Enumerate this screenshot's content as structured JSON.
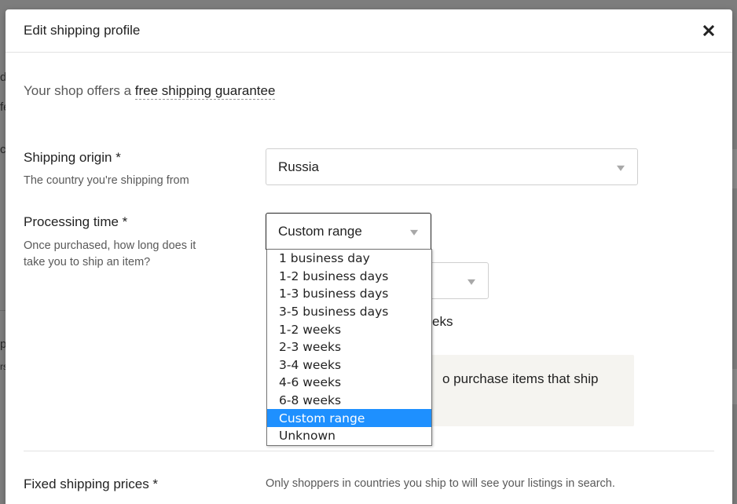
{
  "background": {
    "fragments": [
      "d",
      "fe",
      "ci",
      "p",
      "rs"
    ]
  },
  "modal": {
    "title": "Edit shipping profile",
    "close_icon": "close-icon"
  },
  "guarantee": {
    "prefix": "Your shop offers a ",
    "link": "free shipping guarantee"
  },
  "shipping_origin": {
    "label": "Shipping origin *",
    "help": "The country you're shipping from",
    "value": "Russia"
  },
  "processing_time": {
    "label": "Processing time *",
    "help_line1": "Once purchased, how long does it",
    "help_line2": "take you to ship an item?",
    "value": "Custom range",
    "options": [
      "1 business day",
      "1-2 business days",
      "1-3 business days",
      "3-5 business days",
      "1-2 weeks",
      "2-3 weeks",
      "3-4 weeks",
      "4-6 weeks",
      "6-8 weeks",
      "Custom range",
      "Unknown"
    ],
    "selected_index": 9
  },
  "obscured": {
    "weeks_fragment": "eks",
    "info_fragment": "o purchase items that ship"
  },
  "fixed_shipping": {
    "label": "Fixed shipping prices *",
    "help": "Only shoppers in countries you ship to will see your listings in search."
  },
  "colors": {
    "overlay": "#7f7f7f",
    "highlight": "#1e90ff",
    "info_box": "#f5f4f0"
  }
}
